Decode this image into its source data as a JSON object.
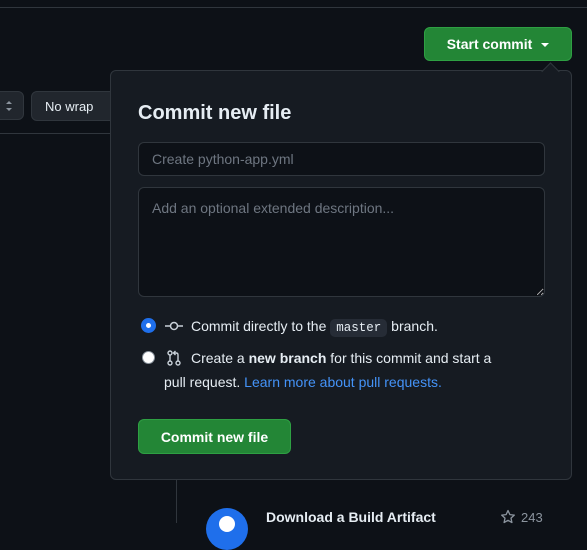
{
  "toolbar": {
    "wrap_mode": "No wrap",
    "start_commit_label": "Start commit"
  },
  "commit_panel": {
    "title": "Commit new file",
    "summary_placeholder": "Create python-app.yml",
    "description_placeholder": "Add an optional extended description...",
    "option_direct": {
      "prefix": "Commit directly to the",
      "branch": "master",
      "suffix": "branch.",
      "checked": true
    },
    "option_new_branch": {
      "prefix": "Create a",
      "bold": "new branch",
      "middle": "for this commit and start a",
      "line2": "pull request.",
      "link": "Learn more about pull requests.",
      "checked": false
    },
    "submit_label": "Commit new file"
  },
  "marketplace": {
    "item_title": "Download a Build Artifact",
    "stars": "243"
  },
  "icons": {
    "indent": "unfold-icon",
    "commit": "git-commit-icon",
    "pull_request": "git-pull-request-icon",
    "star": "star-icon"
  },
  "colors": {
    "background": "#0d1117",
    "panel": "#161b22",
    "border": "#30363d",
    "primary_button": "#238636",
    "link": "#4493f8",
    "radio_accent": "#1f6feb"
  }
}
